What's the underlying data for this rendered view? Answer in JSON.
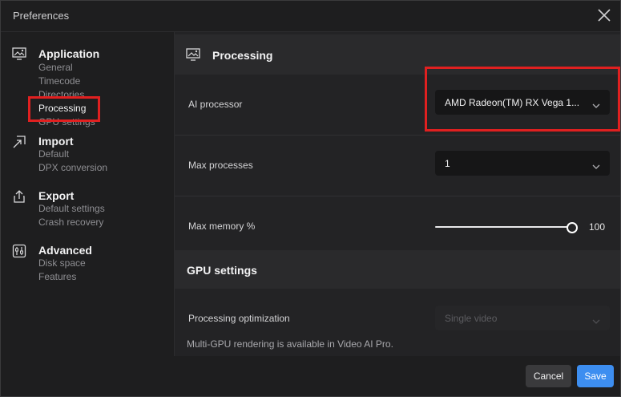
{
  "window": {
    "title": "Preferences"
  },
  "sidebar": {
    "groups": [
      {
        "icon": "monitor-image-icon",
        "title": "Application",
        "items": [
          "General",
          "Timecode",
          "Directories",
          "Processing",
          "GPU settings"
        ]
      },
      {
        "icon": "import-arrow-icon",
        "title": "Import",
        "items": [
          "Default",
          "DPX conversion"
        ]
      },
      {
        "icon": "export-share-icon",
        "title": "Export",
        "items": [
          "Default settings",
          "Crash recovery"
        ]
      },
      {
        "icon": "sliders-icon",
        "title": "Advanced",
        "items": [
          "Disk space",
          "Features"
        ]
      }
    ],
    "active_item": "Processing"
  },
  "processing": {
    "title": "Processing",
    "ai_processor": {
      "label": "AI processor",
      "value": "AMD Radeon(TM) RX Vega 1..."
    },
    "max_processes": {
      "label": "Max processes",
      "value": "1"
    },
    "max_memory": {
      "label": "Max memory %",
      "value": "100",
      "fraction": 1.0
    }
  },
  "gpu_settings": {
    "title": "GPU settings",
    "optimization": {
      "label": "Processing optimization",
      "value": "Single video",
      "enabled": false
    },
    "note": "Multi-GPU rendering is available in Video AI Pro."
  },
  "footer": {
    "cancel_label": "Cancel",
    "save_label": "Save"
  },
  "colors": {
    "accent": "#3d8ef0",
    "highlight": "#e02020",
    "background": "#1e1e1f"
  }
}
